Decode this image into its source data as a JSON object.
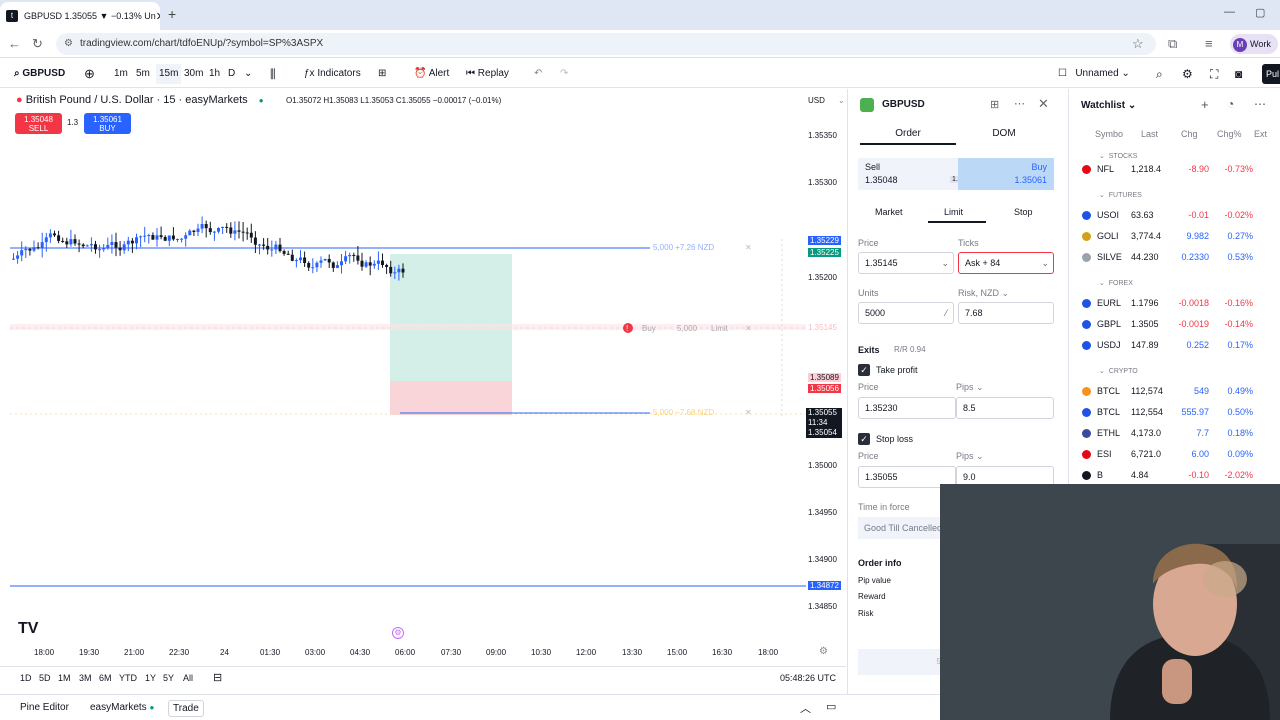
{
  "browser": {
    "tab_title": "GBPUSD 1.35055 ▼ −0.13% Un",
    "url": "tradingview.com/chart/tdfoENUp/?symbol=SP%3ASPX",
    "profile_label": "Work",
    "profile_initial": "M"
  },
  "toolbar": {
    "symbol": "GBPUSD",
    "intervals": [
      "1m",
      "5m",
      "15m",
      "30m",
      "1h",
      "D"
    ],
    "indicators": "Indicators",
    "alert": "Alert",
    "replay": "Replay",
    "layout_name": "Unnamed",
    "publish": "Pul"
  },
  "chart": {
    "title": "British Pound / U.S. Dollar · 15 · easyMarkets",
    "ohlc": "O1.35072 H1.35083 L1.35053 C1.35055 −0.00017 (−0.01%)",
    "sell_price": "1.35048",
    "sell_label": "SELL",
    "spread": "1.3",
    "buy_price": "1.35061",
    "buy_label": "BUY",
    "currency": "USD",
    "price_ticks": [
      "1.35350",
      "1.35300",
      "1.35250",
      "1.35200",
      "1.35150",
      "1.35100",
      "1.35050",
      "1.35000",
      "1.34950",
      "1.34900",
      "1.34850"
    ],
    "tp_label": "5,000 +7.26 NZD",
    "tp_price": "1.35229",
    "tp_price2": "1.35225",
    "order_label_buy": "Buy",
    "order_label_qty": "5,000",
    "order_label_type": "Limit",
    "order_price": "1.35145",
    "sl_label": "5,000 −7.68 NZD",
    "p1": "1.35089",
    "p2": "1.35056",
    "current": "1.35055",
    "countdown": "11:34",
    "current2": "1.35054",
    "low_line": "1.34872",
    "time_ticks": [
      "18:00",
      "19:30",
      "21:00",
      "22:30",
      "24",
      "01:30",
      "03:00",
      "04:30",
      "06:00",
      "07:30",
      "09:00",
      "10:30",
      "12:00",
      "13:30",
      "15:00",
      "16:30",
      "18:00"
    ],
    "ranges": [
      "1D",
      "5D",
      "1M",
      "3M",
      "6M",
      "YTD",
      "1Y",
      "5Y",
      "All"
    ],
    "clock": "05:48:26 UTC"
  },
  "bottom": {
    "pine": "Pine Editor",
    "broker": "easyMarkets",
    "trade": "Trade"
  },
  "order_panel": {
    "symbol": "GBPUSD",
    "tab_order": "Order",
    "tab_dom": "DOM",
    "sell_label": "Sell",
    "sell_price": "1.35048",
    "spread": "1.3",
    "buy_label": "Buy",
    "buy_price": "1.35061",
    "type_market": "Market",
    "type_limit": "Limit",
    "type_stop": "Stop",
    "price_label": "Price",
    "price_value": "1.35145",
    "ticks_label": "Ticks",
    "ticks_value": "Ask + 84",
    "units_label": "Units",
    "units_value": "5000",
    "risk_label": "Risk, NZD",
    "risk_value": "7.68",
    "exits_label": "Exits",
    "rr": "R/R 0.94",
    "tp_label": "Take profit",
    "tp_price_label": "Price",
    "tp_price": "1.35230",
    "tp_pips_label": "Pips",
    "tp_pips": "8.5",
    "sl_label": "Stop loss",
    "sl_price_label": "Price",
    "sl_price": "1.35055",
    "sl_pips_label": "Pips",
    "sl_pips": "9.0",
    "tif_label": "Time in force",
    "tif_value": "Good Till Cancelled",
    "info_label": "Order info",
    "pip_value": "Pip value",
    "reward": "Reward",
    "risk": "Risk",
    "submit": "5,000 GBP"
  },
  "watchlist": {
    "title": "Watchlist",
    "cols": [
      "Symbo",
      "Last",
      "Chg",
      "Chg%",
      "Ext"
    ],
    "sections": {
      "stocks": "STOCKS",
      "futures": "FUTURES",
      "forex": "FOREX",
      "crypto": "CRYPTO"
    },
    "rows": [
      {
        "sym": "NFL",
        "last": "1,218.4",
        "chg": "-8.90",
        "pct": "-0.73%",
        "color": "#e50914"
      },
      {
        "sym": "USOI",
        "last": "63.63",
        "chg": "-0.01",
        "pct": "-0.02%",
        "color": "#1e53e5"
      },
      {
        "sym": "GOLI",
        "last": "3,774.4",
        "chg": "9.982",
        "pct": "0.27%",
        "color": "#d4a017"
      },
      {
        "sym": "SILVE",
        "last": "44.230",
        "chg": "0.2330",
        "pct": "0.53%",
        "color": "#9aa3ad"
      },
      {
        "sym": "EURL",
        "last": "1.1796",
        "chg": "-0.0018",
        "pct": "-0.16%",
        "color": "#1e53e5"
      },
      {
        "sym": "GBPL",
        "last": "1.3505",
        "chg": "-0.0019",
        "pct": "-0.14%",
        "color": "#1e53e5"
      },
      {
        "sym": "USDJ",
        "last": "147.89",
        "chg": "0.252",
        "pct": "0.17%",
        "color": "#1e53e5"
      },
      {
        "sym": "BTCL",
        "last": "112,574",
        "chg": "549",
        "pct": "0.49%",
        "color": "#f7931a"
      },
      {
        "sym": "BTCL",
        "last": "112,554",
        "chg": "555.97",
        "pct": "0.50%",
        "color": "#1e53e5"
      },
      {
        "sym": "ETHL",
        "last": "4,173.0",
        "chg": "7.7",
        "pct": "0.18%",
        "color": "#3c4a9e"
      },
      {
        "sym": "ESI",
        "last": "6,721.0",
        "chg": "6.00",
        "pct": "0.09%",
        "color": "#e50914"
      },
      {
        "sym": "B",
        "last": "4.84",
        "chg": "-0.10",
        "pct": "-2.02%",
        "color": "#131722"
      }
    ]
  },
  "colors": {
    "up": "#2962ff",
    "down": "#131722",
    "red": "#f23645",
    "green": "#089981",
    "blue": "#2962ff"
  }
}
